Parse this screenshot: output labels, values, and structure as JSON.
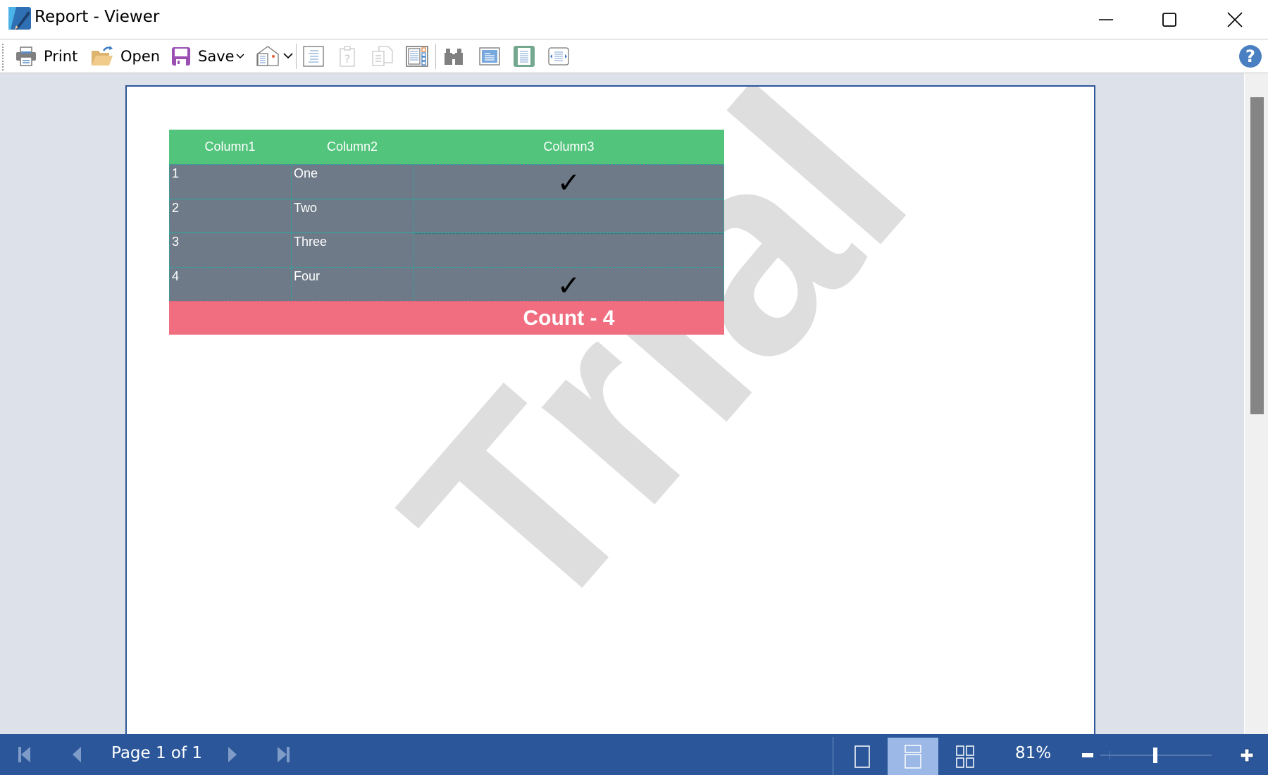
{
  "window": {
    "title": "Report - Viewer",
    "controls": [
      "minimize",
      "maximize",
      "close"
    ]
  },
  "toolbar": {
    "print_label": "Print",
    "open_label": "Open",
    "save_label": "Save",
    "icons": [
      "printer-icon",
      "open-folder-icon",
      "save-disk-icon",
      "send-email-icon",
      "table-of-contents-icon",
      "parameters-icon",
      "copy-icon",
      "thumbnails-icon",
      "find-binoculars-icon",
      "single-page-icon",
      "full-page-icon",
      "page-width-icon",
      "help-icon"
    ],
    "help_label": "?"
  },
  "report": {
    "headers": [
      "Column1",
      "Column2",
      "Column3"
    ],
    "rows": [
      {
        "col1": "1",
        "col2": "One",
        "checked": true
      },
      {
        "col1": "2",
        "col2": "Two",
        "checked": false
      },
      {
        "col1": "3",
        "col2": "Three",
        "checked": false
      },
      {
        "col1": "4",
        "col2": "Four",
        "checked": true
      }
    ],
    "check_glyph": "✓",
    "footer_text": "Count - 4",
    "watermark": "Trial",
    "colors": {
      "header": "#52c47c",
      "row": "#6e7a87",
      "footer": "#f06e80",
      "grid": "#2aa8a0"
    }
  },
  "statusbar": {
    "page_info": "Page 1 of 1",
    "zoom_percent": "81%",
    "zoom_level": 0.81,
    "view_modes": [
      "single-page",
      "continuous",
      "multiple-pages"
    ],
    "active_view_mode": "continuous",
    "color": "#2b579a"
  }
}
